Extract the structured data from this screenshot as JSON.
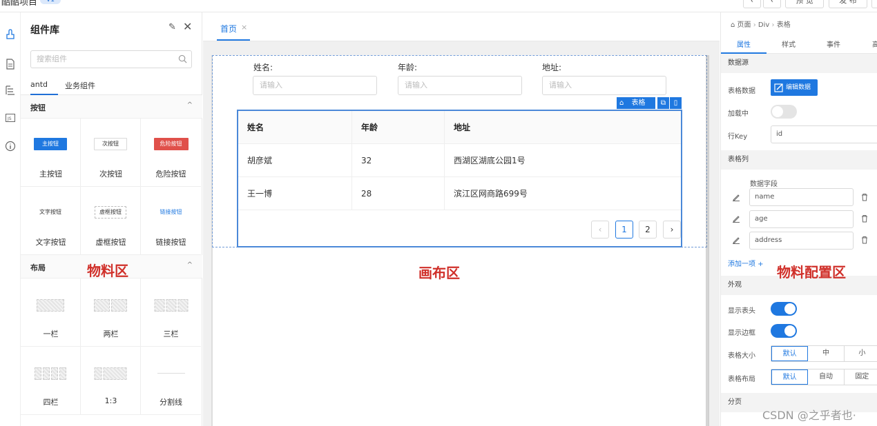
{
  "topbar": {
    "project": "酷酷项目",
    "badge": "V1",
    "preview": "预 览",
    "publish": "发 布"
  },
  "left_panel": {
    "title": "组件库",
    "search_placeholder": "搜索组件",
    "tabs": [
      "antd",
      "业务组件"
    ],
    "sections": {
      "buttons": {
        "title": "按钮",
        "items": [
          {
            "label": "主按钮",
            "preview": "主按钮"
          },
          {
            "label": "次按钮",
            "preview": "次按钮"
          },
          {
            "label": "危险按钮",
            "preview": "危险按钮"
          },
          {
            "label": "文字按钮",
            "preview": "文字按钮"
          },
          {
            "label": "虚框按钮",
            "preview": "虚框按钮"
          },
          {
            "label": "链接按钮",
            "preview": "链接按钮"
          }
        ]
      },
      "layout": {
        "title": "布局",
        "items": [
          {
            "label": "一栏"
          },
          {
            "label": "两栏"
          },
          {
            "label": "三栏"
          },
          {
            "label": "四栏"
          },
          {
            "label": "1:3"
          },
          {
            "label": "分割线"
          }
        ]
      }
    },
    "annotation": "物料区"
  },
  "center": {
    "tab": "首页",
    "form": {
      "fields": [
        {
          "label": "姓名:",
          "placeholder": "请输入"
        },
        {
          "label": "年龄:",
          "placeholder": "请输入"
        },
        {
          "label": "地址:",
          "placeholder": "请输入"
        }
      ]
    },
    "selection_tag": "表格",
    "table": {
      "columns": [
        "姓名",
        "年龄",
        "地址"
      ],
      "rows": [
        [
          "胡彦斌",
          "32",
          "西湖区湖底公园1号"
        ],
        [
          "王一博",
          "28",
          "滨江区网商路699号"
        ]
      ],
      "pagination": {
        "pages": [
          "1",
          "2"
        ],
        "current": "1"
      }
    },
    "annotation": "画布区"
  },
  "right_panel": {
    "breadcrumb": [
      "页面",
      "Div",
      "表格"
    ],
    "tabs": [
      "属性",
      "样式",
      "事件",
      "高"
    ],
    "sections": {
      "datasource": "数据源",
      "columns": "表格列",
      "appearance": "外观",
      "pagination": "分页"
    },
    "table_data_label": "表格数据",
    "edit_data_button": "编辑数据",
    "loading_label": "加载中",
    "row_key_label": "行Key",
    "row_key_value": "id",
    "data_field_header": "数据字段",
    "column_fields": [
      "name",
      "age",
      "address"
    ],
    "add_item": "添加一项 +",
    "show_header_label": "显示表头",
    "show_border_label": "显示边框",
    "table_size_label": "表格大小",
    "table_size_options": [
      "默认",
      "中",
      "小"
    ],
    "table_layout_label": "表格布局",
    "table_layout_options": [
      "默认",
      "自动",
      "固定"
    ],
    "annotation": "物料配置区"
  },
  "watermark": "CSDN @之乎者也·"
}
